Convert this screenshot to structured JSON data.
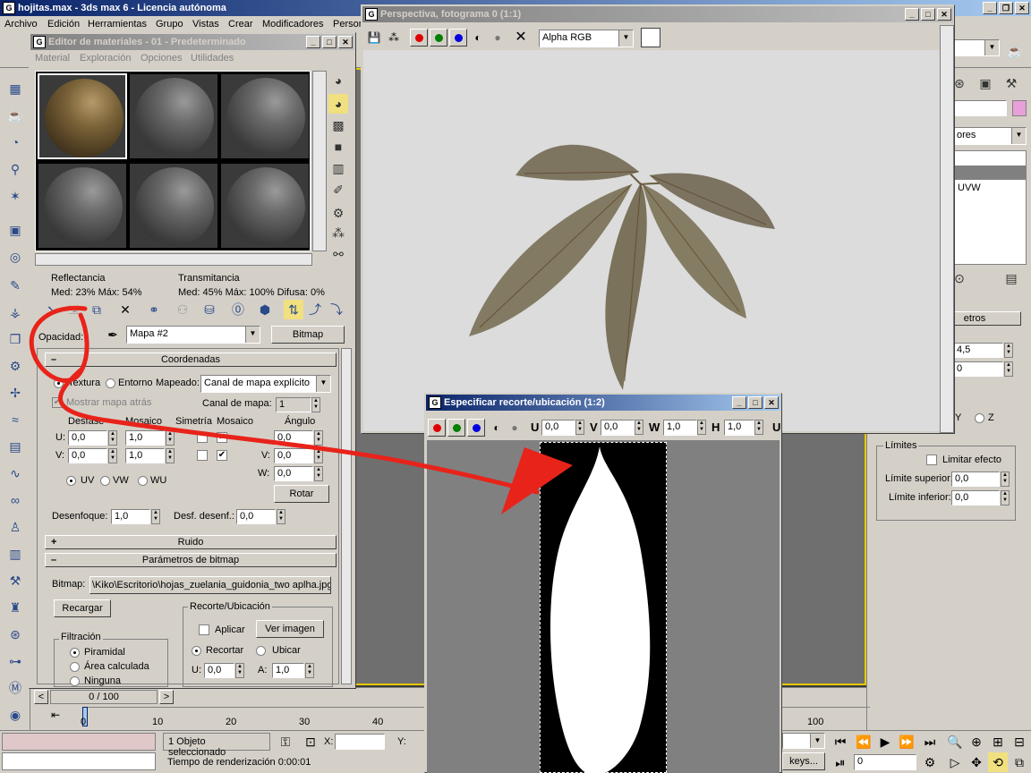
{
  "main": {
    "title": "hojitas.max - 3ds max 6 - Licencia autónoma",
    "menu": [
      "Archivo",
      "Edición",
      "Herramientas",
      "Grupo",
      "Vistas",
      "Crear",
      "Modificadores",
      "Persor"
    ]
  },
  "material_editor": {
    "title": "Editor de materiales - 01 - Predeterminado",
    "menu": [
      "Material",
      "Exploración",
      "Opciones",
      "Utilidades"
    ],
    "reflectance": {
      "label": "Reflectancia",
      "line": "Med:  23% Máx:  54%"
    },
    "transmittance": {
      "label": "Transmitancia",
      "line": "Med:  45% Máx: 100%  Difusa:      0%"
    },
    "opacity_label": "Opacidad:",
    "map_name": "Mapa #2",
    "bitmap_button": "Bitmap",
    "coords": {
      "title": "Coordenadas",
      "texture": "Textura",
      "environ": "Entorno",
      "mapping_label": "Mapeado:",
      "mapping_value": "Canal de mapa explícito",
      "show_map": "Mostrar mapa atrás",
      "map_channel_label": "Canal de mapa:",
      "map_channel": "1",
      "offset": "Desfase",
      "tiling": "Mosaico",
      "mirror": "Simetría",
      "tile": "Mosaico",
      "angle": "Ángulo",
      "u": "U:",
      "v": "V:",
      "w": "W:",
      "u_off": "0,0",
      "v_off": "0,0",
      "u_til": "1,0",
      "v_til": "1,0",
      "u_ang": "0,0",
      "v_ang": "0,0",
      "w_ang": "0,0",
      "uv": "UV",
      "vw": "VW",
      "wu": "WU",
      "rotate": "Rotar",
      "blur_label": "Desenfoque:",
      "blur": "1,0",
      "blur_off_label": "Desf. desenf.:",
      "blur_off": "0,0"
    },
    "noise": {
      "title": "Ruido"
    },
    "bitmap_params": {
      "title": "Parámetros de bitmap",
      "bitmap_label": "Bitmap:",
      "path": "\\Kiko\\Escritorio\\hojas_zuelania_guidonia_two aplha.jpg",
      "reload": "Recargar",
      "crop_group": "Recorte/Ubicación",
      "apply": "Aplicar",
      "view_image": "Ver imagen",
      "crop": "Recortar",
      "place": "Ubicar",
      "u_label": "U:",
      "u": "0,0",
      "a_label": "A:",
      "a": "1,0",
      "filter_group": "Filtración",
      "pyramidal": "Piramidal",
      "summed": "Área calculada",
      "none": "Ninguna"
    }
  },
  "perspective": {
    "title": "Perspectiva, fotograma 0 (1:1)",
    "channel": "Alpha RGB"
  },
  "crop_window": {
    "title": "Especificar recorte/ubicación (1:2)",
    "u_label": "U",
    "u": "0,0",
    "v_label": "V",
    "v": "0,0",
    "w_label": "W",
    "w": "1,0",
    "h_label": "H",
    "h": "1,0",
    "u2": "U"
  },
  "right_panel": {
    "dropdown": "ores",
    "uvw": "UVW",
    "rollout": "etros",
    "val1": "4,5",
    "val2": "0",
    "y": "Y",
    "z": "Z",
    "limits": "Límites",
    "limit_effect": "Limitar efecto",
    "upper_label": "Límite superior:",
    "upper": "0,0",
    "lower_label": "Límite inferior:",
    "lower": "0,0"
  },
  "timeline": {
    "frame": "0 / 100",
    "ticks": [
      "0",
      "10",
      "20",
      "30",
      "40",
      "100"
    ]
  },
  "status": {
    "selected": "1 Objeto seleccionado",
    "x_label": "X:",
    "y_label": "Y:",
    "render_time": "Tiempo de renderización  0:00:01",
    "keys": "keys...",
    "frame_field": "0"
  },
  "colors": {
    "title_active": "#0a246a",
    "title_inactive": "#808080",
    "annotation": "#e8231a",
    "face": "#d4d0c8"
  }
}
